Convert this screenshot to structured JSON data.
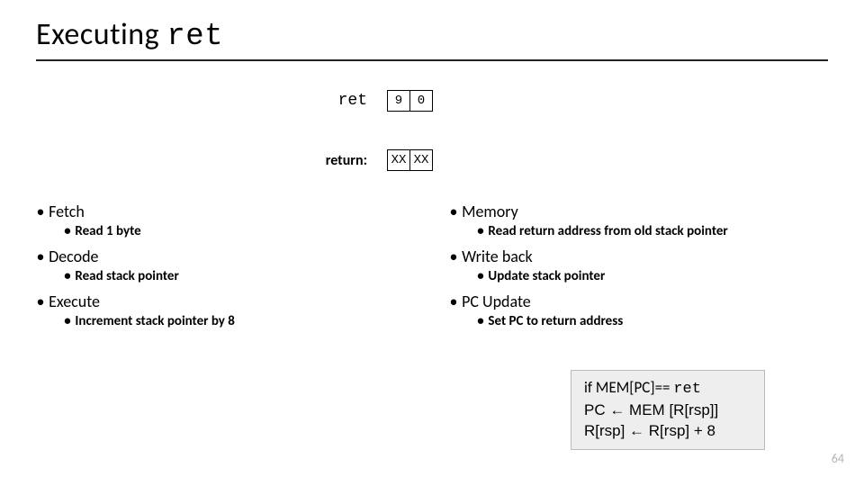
{
  "title_prefix": "Executing ",
  "title_mono": "ret",
  "rows": {
    "ret": {
      "label": "ret",
      "b0": "9",
      "b1": "0"
    },
    "return": {
      "label": "return:",
      "b0": "XX",
      "b1": "XX"
    }
  },
  "left": {
    "fetch": {
      "h": "Fetch",
      "i": "Read 1 byte"
    },
    "decode": {
      "h": "Decode",
      "i": "Read stack pointer"
    },
    "execute": {
      "h": "Execute",
      "i": "Increment stack pointer by 8"
    }
  },
  "right": {
    "memory": {
      "h": "Memory",
      "i": "Read return address from old stack pointer"
    },
    "writeback": {
      "h": "Write back",
      "i": "Update stack pointer"
    },
    "pcupdate": {
      "h": "PC Update",
      "i": "Set PC to return address"
    }
  },
  "pseudocode": {
    "l1a": "if MEM[PC]== ",
    "l1b": "ret",
    "l2": "PC ← MEM [R[rsp]]",
    "l3": "R[rsp] ← R[rsp] + 8"
  },
  "pagenum": "64",
  "bullets": {
    "disc": "•"
  }
}
